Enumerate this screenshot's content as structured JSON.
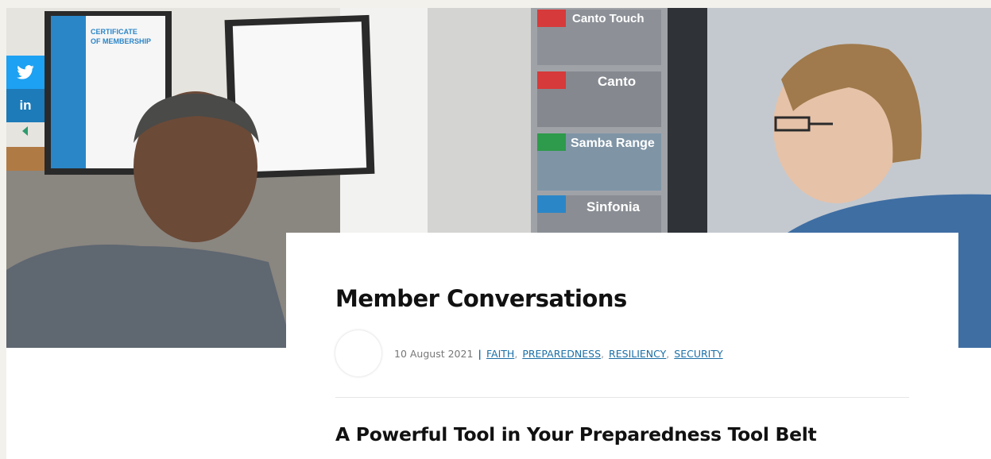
{
  "social": {
    "twitter_icon": "twitter-icon",
    "linkedin_label": "in",
    "collapse_icon": "triangle-left-icon"
  },
  "hero": {
    "certificate_line1": "CERTIFICATE",
    "certificate_line2": "OF MEMBERSHIP",
    "brochures": [
      "Canto Touch",
      "Canto",
      "Samba Range",
      "Sinfonia"
    ],
    "colors": {
      "twitter": "#1da1f2",
      "linkedin": "#1c7bb8"
    }
  },
  "article": {
    "title": "Member Conversations",
    "date": "10 August 2021",
    "separator": "|",
    "categories": [
      "FAITH",
      "PREPAREDNESS",
      "RESILIENCY",
      "SECURITY"
    ],
    "subtitle": "A Powerful Tool in Your Preparedness Tool Belt",
    "link_color": "#1c6fa6"
  }
}
